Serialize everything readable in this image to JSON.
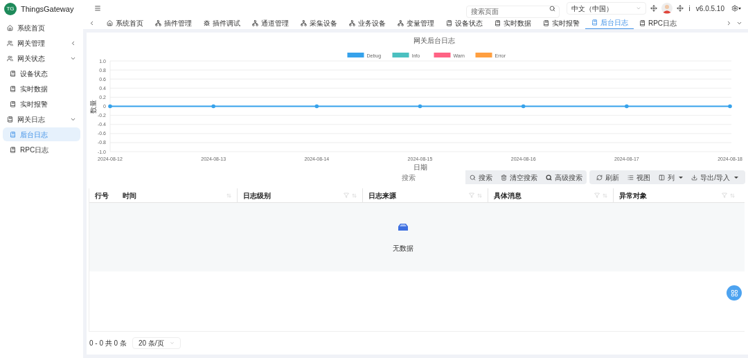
{
  "brand": {
    "logo": "TG",
    "name": "ThingsGateway"
  },
  "sidebar": {
    "items": [
      {
        "label": "系统首页",
        "kind": "home",
        "expanded": false,
        "selected": false
      },
      {
        "label": "网关管理",
        "kind": "users",
        "expanded": false,
        "selected": false
      },
      {
        "label": "网关状态",
        "kind": "users",
        "expanded": true,
        "selected": false,
        "children": [
          {
            "label": "设备状态",
            "kind": "book",
            "selected": false
          },
          {
            "label": "实时数据",
            "kind": "book",
            "selected": false
          },
          {
            "label": "实时报警",
            "kind": "book",
            "selected": false
          }
        ]
      },
      {
        "label": "网关日志",
        "kind": "book",
        "expanded": true,
        "selected": false,
        "children": [
          {
            "label": "后台日志",
            "kind": "book",
            "selected": true
          },
          {
            "label": "RPC日志",
            "kind": "book",
            "selected": false
          }
        ]
      }
    ]
  },
  "header": {
    "search": {
      "placeholder": "搜索页面"
    },
    "language": "中文（中国）",
    "version": "v6.0.5.10",
    "info": "i"
  },
  "tabs": [
    {
      "label": "系统首页",
      "kind": "home",
      "selected": false
    },
    {
      "label": "插件管理",
      "kind": "network",
      "selected": false
    },
    {
      "label": "插件调试",
      "kind": "bug",
      "selected": false
    },
    {
      "label": "通道管理",
      "kind": "network",
      "selected": false
    },
    {
      "label": "采集设备",
      "kind": "network",
      "selected": false
    },
    {
      "label": "业务设备",
      "kind": "network",
      "selected": false
    },
    {
      "label": "变量管理",
      "kind": "network",
      "selected": false
    },
    {
      "label": "设备状态",
      "kind": "book",
      "selected": false
    },
    {
      "label": "实时数据",
      "kind": "book",
      "selected": false
    },
    {
      "label": "实时报警",
      "kind": "book",
      "selected": false
    },
    {
      "label": "后台日志",
      "kind": "book",
      "selected": true
    },
    {
      "label": "RPC日志",
      "kind": "book",
      "selected": false
    }
  ],
  "chart": {
    "chart_data": {
      "type": "line",
      "title": "网关后台日志",
      "xlabel": "日期",
      "ylabel": "数量",
      "categories": [
        "2024-08-12",
        "2024-08-13",
        "2024-08-14",
        "2024-08-15",
        "2024-08-16",
        "2024-08-17",
        "2024-08-18"
      ],
      "series": [
        {
          "name": "Debug",
          "color": "#36a2eb",
          "values": [
            0,
            0,
            0,
            0,
            0,
            0,
            0
          ]
        },
        {
          "name": "Info",
          "color": "#4bc0c0",
          "values": [
            null,
            null,
            null,
            null,
            null,
            null,
            null
          ]
        },
        {
          "name": "Warn",
          "color": "#ff6384",
          "values": [
            null,
            null,
            null,
            null,
            null,
            null,
            null
          ]
        },
        {
          "name": "Error",
          "color": "#ff9f40",
          "values": [
            null,
            null,
            null,
            null,
            null,
            null,
            null
          ]
        }
      ],
      "grid": true,
      "legend": true,
      "ylim": [
        -1,
        1
      ],
      "yticks": [
        {
          "value": 1,
          "label": "1.0"
        },
        {
          "value": 0.8,
          "label": "0.8"
        },
        {
          "value": 0.6,
          "label": "0.6"
        },
        {
          "value": 0.4,
          "label": "0.4"
        },
        {
          "value": 0.2,
          "label": "0.2"
        },
        {
          "value": 0,
          "label": "0"
        },
        {
          "value": -0.2,
          "label": "-0.2"
        },
        {
          "value": -0.4,
          "label": "-0.4"
        },
        {
          "value": -0.6,
          "label": "-0.6"
        },
        {
          "value": -0.8,
          "label": "-0.8"
        },
        {
          "value": -1,
          "label": "-1.0"
        }
      ]
    }
  },
  "toolbar": {
    "search": {
      "placeholder": "搜索"
    },
    "buttons": [
      {
        "label": "搜索",
        "kind": "search"
      },
      {
        "label": "清空搜索",
        "kind": "trash"
      },
      {
        "label": "高级搜索",
        "kind": "search-bold"
      }
    ],
    "tools": [
      {
        "label": "刷新",
        "kind": "refresh",
        "dropdown": false
      },
      {
        "label": "视图",
        "kind": "list",
        "dropdown": false
      },
      {
        "label": "列",
        "kind": "columns",
        "dropdown": true
      },
      {
        "label": "导出/导入",
        "kind": "download",
        "dropdown": true
      }
    ]
  },
  "table": {
    "columns": [
      {
        "label": "行号"
      },
      {
        "label": "时间",
        "filter": false,
        "sort": true
      },
      {
        "label": "日志级别",
        "filter": true,
        "sort": true
      },
      {
        "label": "日志来源",
        "filter": true,
        "sort": true
      },
      {
        "label": "具体消息",
        "filter": true,
        "sort": true
      },
      {
        "label": "异常对象",
        "filter": true,
        "sort": true
      }
    ],
    "empty": "无数据"
  },
  "pagination": {
    "summary": "0 - 0 共 0 条",
    "page_size": "20 条/页"
  }
}
